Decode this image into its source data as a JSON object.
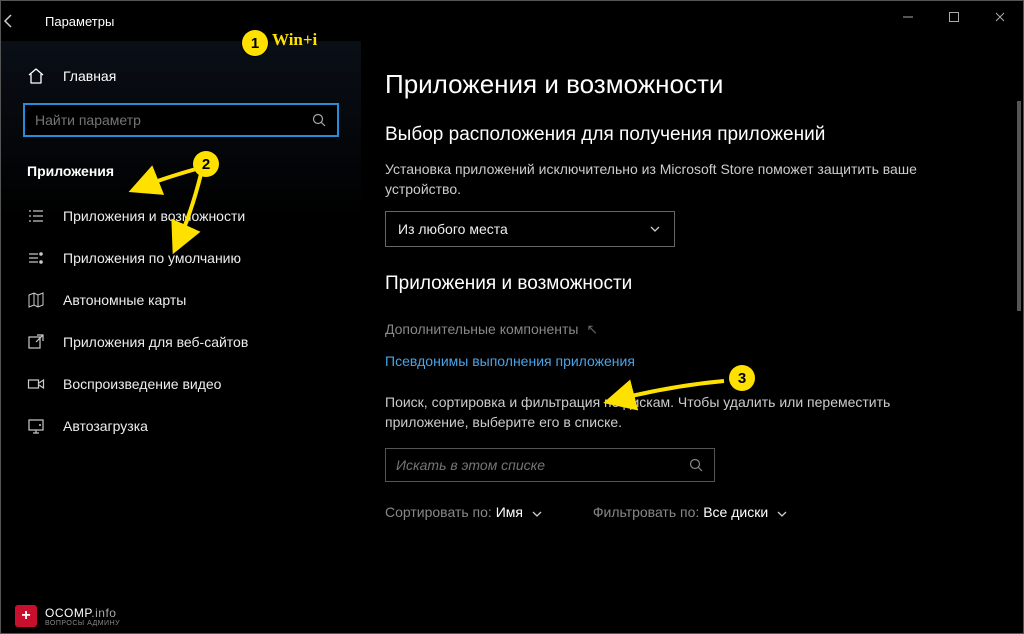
{
  "titlebar": {
    "title": "Параметры"
  },
  "annotations": {
    "badge1_label": "Win+i",
    "badge1": "1",
    "badge2": "2",
    "badge3": "3"
  },
  "sidebar": {
    "home": "Главная",
    "search_placeholder": "Найти параметр",
    "category": "Приложения",
    "items": [
      {
        "label": "Приложения и возможности"
      },
      {
        "label": "Приложения по умолчанию"
      },
      {
        "label": "Автономные карты"
      },
      {
        "label": "Приложения для веб-сайтов"
      },
      {
        "label": "Воспроизведение видео"
      },
      {
        "label": "Автозагрузка"
      }
    ]
  },
  "main": {
    "h1": "Приложения и возможности",
    "section1_title": "Выбор расположения для получения приложений",
    "section1_desc": "Установка приложений исключительно из Microsoft Store поможет защитить ваше устройство.",
    "combo_value": "Из любого места",
    "section2_title": "Приложения и возможности",
    "link_optional": "Дополнительные компоненты",
    "link_aliases": "Псевдонимы выполнения приложения",
    "filter_desc": "Поиск, сортировка и фильтрация по дискам. Чтобы удалить или переместить приложение, выберите его в списке.",
    "filter_placeholder": "Искать в этом списке",
    "sort_label": "Сортировать по:",
    "sort_value": "Имя",
    "filter_label": "Фильтровать по:",
    "filter_value": "Все диски"
  },
  "watermark": {
    "brand": "OCOMP",
    "suffix": ".info",
    "sub": "ВОПРОСЫ АДМИНУ"
  }
}
